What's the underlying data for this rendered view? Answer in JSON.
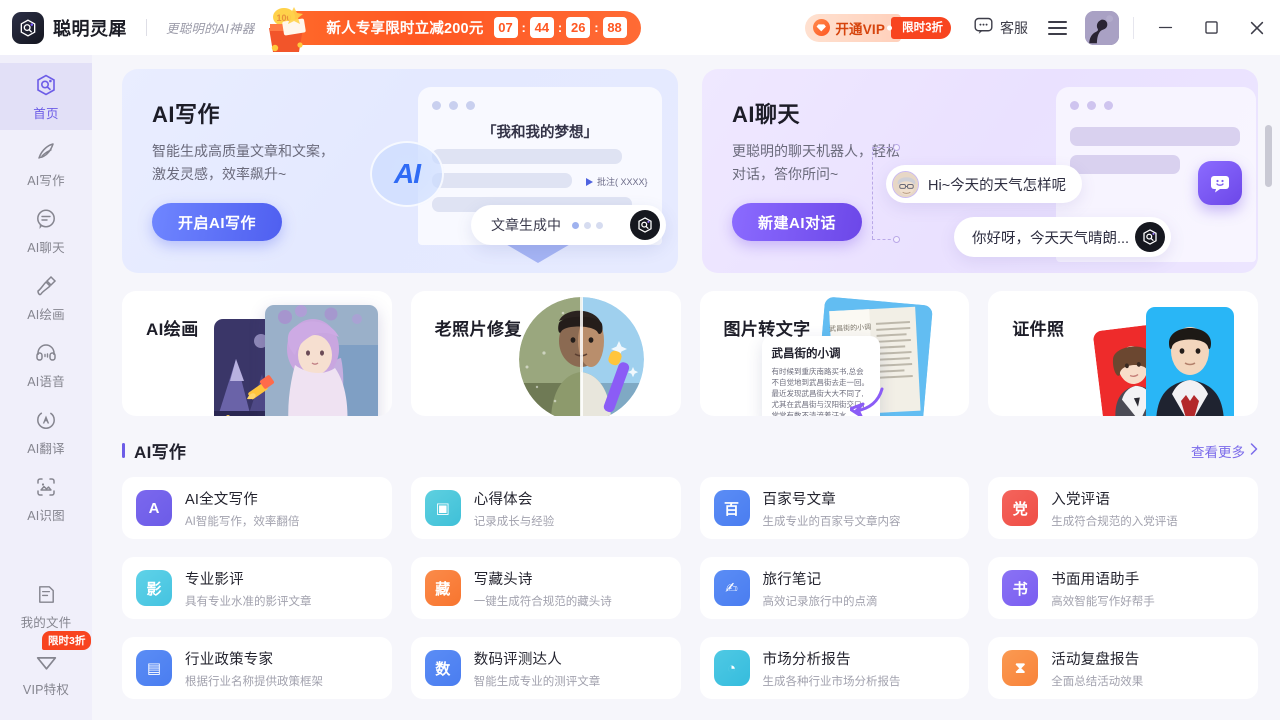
{
  "titlebar": {
    "brand_name": "聪明灵犀",
    "brand_slogan": "更聪明的AI神器",
    "promo_text": "新人专享限时立减200元",
    "timer": {
      "h": "07",
      "m": "44",
      "s": "26",
      "ms": "88",
      "sep": ":"
    },
    "vip_label": "开通VIP",
    "vip_tag": "限时3折",
    "support_label": "客服",
    "window_minimize": "—",
    "window_maximize": "□",
    "window_close": "✕"
  },
  "sidebar": {
    "items": [
      {
        "label": "首页",
        "icon": "home-hex-icon",
        "active": true
      },
      {
        "label": "AI写作",
        "icon": "pen-icon",
        "active": false
      },
      {
        "label": "AI聊天",
        "icon": "chat-bubble-icon",
        "active": false
      },
      {
        "label": "AI绘画",
        "icon": "brush-icon",
        "active": false
      },
      {
        "label": "AI语音",
        "icon": "headphone-icon",
        "active": false
      },
      {
        "label": "AI翻译",
        "icon": "translate-circle-icon",
        "active": false
      },
      {
        "label": "AI识图",
        "icon": "image-scan-icon",
        "active": false
      }
    ],
    "bottom": [
      {
        "label": "我的文件",
        "icon": "file-icon",
        "badge": ""
      },
      {
        "label": "VIP特权",
        "icon": "vip-diamond-icon",
        "badge": "限时3折"
      }
    ]
  },
  "banners": [
    {
      "title": "AI写作",
      "desc_line1": "智能生成高质量文章和文案，",
      "desc_line2": "激发灵感，效率飙升~",
      "button": "开启AI写作",
      "mock_heading": "「我和我的梦想」",
      "mock_tag": "批注( XXXX}",
      "status_text": "文章生成中",
      "orb_text": "AI"
    },
    {
      "title": "AI聊天",
      "desc_line1": "更聪明的聊天机器人，轻松",
      "desc_line2": "对话，答你所问~",
      "button": "新建AI对话",
      "bubble_user": "Hi~今天的天气怎样呢",
      "bubble_bot": "你好呀，今天天气晴朗..."
    }
  ],
  "features": [
    {
      "title": "AI绘画"
    },
    {
      "title": "老照片修复"
    },
    {
      "title": "图片转文字",
      "doc_title": "武昌街的小调",
      "doc_body": "有时候到重庆南路买书,总会不自觉地到武昌街去走一回。最近发现武昌街大大不同了,尤其在武昌街与汉阳街交口，常常有数不清流着汗水"
    },
    {
      "title": "证件照"
    }
  ],
  "section": {
    "title": "AI写作",
    "more": "查看更多",
    "more_chevron": "›"
  },
  "tools": [
    {
      "name": "AI全文写作",
      "sub": "AI智能写作，效率翻倍",
      "glyph": "A",
      "color": "#7b68ee",
      "color2": "#6c5ce7"
    },
    {
      "name": "心得体会",
      "sub": "记录成长与经验",
      "glyph": "▣",
      "color": "#5ed0e0",
      "color2": "#3fc0d8"
    },
    {
      "name": "百家号文章",
      "sub": "生成专业的百家号文章内容",
      "glyph": "百",
      "color": "#5b8df5",
      "color2": "#4a7df0"
    },
    {
      "name": "入党评语",
      "sub": "生成符合规范的入党评语",
      "glyph": "党",
      "color": "#f4645c",
      "color2": "#ef4e46"
    },
    {
      "name": "专业影评",
      "sub": "具有专业水准的影评文章",
      "glyph": "影",
      "color": "#5fd2e8",
      "color2": "#45c3e0"
    },
    {
      "name": "写藏头诗",
      "sub": "一键生成符合规范的藏头诗",
      "glyph": "藏",
      "color": "#fb8b4a",
      "color2": "#f8752f"
    },
    {
      "name": "旅行笔记",
      "sub": "高效记录旅行中的点滴",
      "glyph": "✍",
      "color": "#5b8df5",
      "color2": "#4a7df0"
    },
    {
      "name": "书面用语助手",
      "sub": "高效智能写作好帮手",
      "glyph": "书",
      "color": "#8a72f5",
      "color2": "#7a5ef0"
    },
    {
      "name": "行业政策专家",
      "sub": "根据行业名称提供政策框架",
      "glyph": "▤",
      "color": "#5b8df5",
      "color2": "#4a7df0"
    },
    {
      "name": "数码评测达人",
      "sub": "智能生成专业的测评文章",
      "glyph": "数",
      "color": "#5b8df5",
      "color2": "#4a7df0"
    },
    {
      "name": "市场分析报告",
      "sub": "生成各种行业市场分析报告",
      "glyph": "◔",
      "color": "#4fc9e4",
      "color2": "#35bcdd"
    },
    {
      "name": "活动复盘报告",
      "sub": "全面总结活动效果",
      "glyph": "⧗",
      "color": "#fb9a52",
      "color2": "#f8833a"
    }
  ],
  "colors": {
    "accent_purple": "#6c5ce7",
    "promo_orange": "#ff5722",
    "sidebar_bg": "#f0effa",
    "content_bg": "#f6f6fb"
  }
}
